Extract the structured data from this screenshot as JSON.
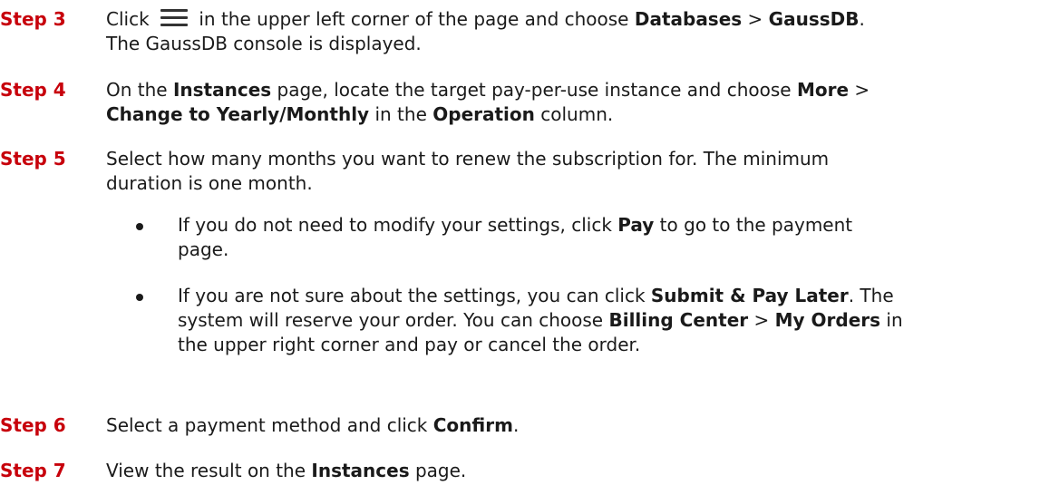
{
  "steps": [
    {
      "label": "Step 3",
      "lines": [
        [
          "Click ",
          "[icon]",
          " in the upper left corner of the page and choose ",
          "**Databases**",
          " > ",
          "**GaussDB**",
          "."
        ],
        [
          "The GaussDB console is displayed."
        ]
      ]
    },
    {
      "label": "Step 4",
      "lines": [
        [
          "On the ",
          "**Instances**",
          " page, locate the target pay-per-use instance and choose ",
          "**More**",
          " >"
        ],
        [
          "**Change to Yearly/Monthly**",
          " in the ",
          "**Operation**",
          " column."
        ]
      ]
    },
    {
      "label": "Step 5",
      "lines": [
        [
          "Select how many months you want to renew the subscription for. The minimum"
        ],
        [
          "duration is one month."
        ]
      ]
    },
    {
      "label": "Step 6",
      "lines": [
        [
          "Select a payment method and click ",
          "**Confirm**",
          "."
        ]
      ]
    },
    {
      "label": "Step 7",
      "lines": [
        [
          "View the result on the ",
          "**Instances**",
          " page."
        ]
      ]
    }
  ],
  "bullets": [
    {
      "lines": [
        [
          "If you do not need to modify your settings, click ",
          "**Pay**",
          " to go to the payment"
        ],
        [
          "page."
        ]
      ]
    },
    {
      "lines": [
        [
          "If you are not sure about the settings, you can click ",
          "**Submit & Pay Later**",
          ". The"
        ],
        [
          "system will reserve your order. You can choose ",
          "**Billing Center**",
          " > ",
          "**My Orders**",
          " in"
        ],
        [
          "the upper right corner and pay or cancel the order."
        ]
      ]
    }
  ],
  "icons": {
    "menu": "hamburger-menu-icon"
  }
}
